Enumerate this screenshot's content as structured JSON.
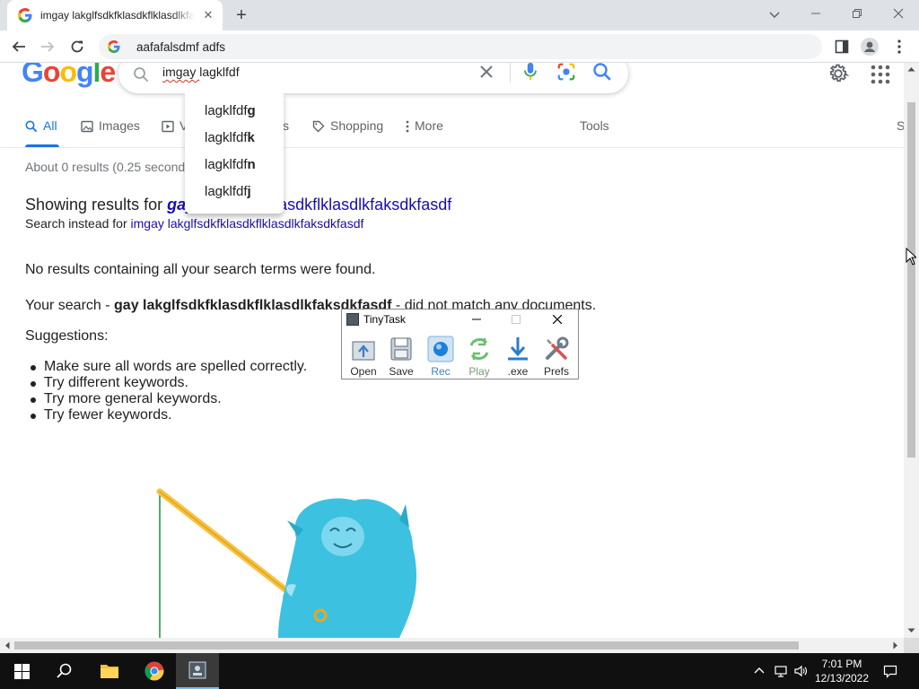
{
  "browser": {
    "tab_title": "imgay lakglfsdkfklasdkflklasdlkfaksdkfasdf - Google Search",
    "address": "aafafalsdmf adfs"
  },
  "search": {
    "query_prefix": "imgay ",
    "query_rest": "lagklfdf"
  },
  "autocomplete": [
    {
      "base": "lagklfdf",
      "bold": "g"
    },
    {
      "base": "lagklfdf",
      "bold": "k"
    },
    {
      "base": "lagklfdf",
      "bold": "n"
    },
    {
      "base": "lagklfdf",
      "bold": "j"
    }
  ],
  "tabs": {
    "all": "All",
    "images": "Images",
    "videos_v": "V",
    "videos_tail": "s",
    "shopping": "Shopping",
    "more": "More",
    "tools": "Tools",
    "safesearch_s": "S"
  },
  "results": {
    "stats": "About 0 results (0.25 seconds)",
    "showing_prefix": "Showing results for ",
    "showing_bold": "gay",
    "showing_rest": " lakglfsdkfklasdkflklasdlkfaksdkfasdf",
    "instead_prefix": "Search instead for ",
    "instead_link": "imgay lakglfsdkfklasdkflklasdlkfaksdkfasdf",
    "no_results": "No results containing all your search terms were found.",
    "your_search_prefix": "Your search - ",
    "your_search_bold": "gay lakglfsdkfklasdkflklasdlkfaksdkfasdf",
    "your_search_suffix": " - did not match any documents.",
    "suggestions_heading": "Suggestions:",
    "suggestions": [
      "Make sure all words are spelled correctly.",
      "Try different keywords.",
      "Try more general keywords.",
      "Try fewer keywords."
    ]
  },
  "tinytask": {
    "title": "TinyTask",
    "buttons": {
      "open": "Open",
      "save": "Save",
      "rec": "Rec",
      "play": "Play",
      "exe": ".exe",
      "prefs": "Prefs"
    }
  },
  "taskbar": {
    "time": "7:01 PM",
    "date": "12/13/2022"
  },
  "colors": {
    "link": "#1a0dab",
    "accent": "#1a73e8",
    "google_blue": "#4285f4",
    "google_red": "#ea4335",
    "google_yellow": "#fbbc05",
    "google_green": "#34a853"
  }
}
